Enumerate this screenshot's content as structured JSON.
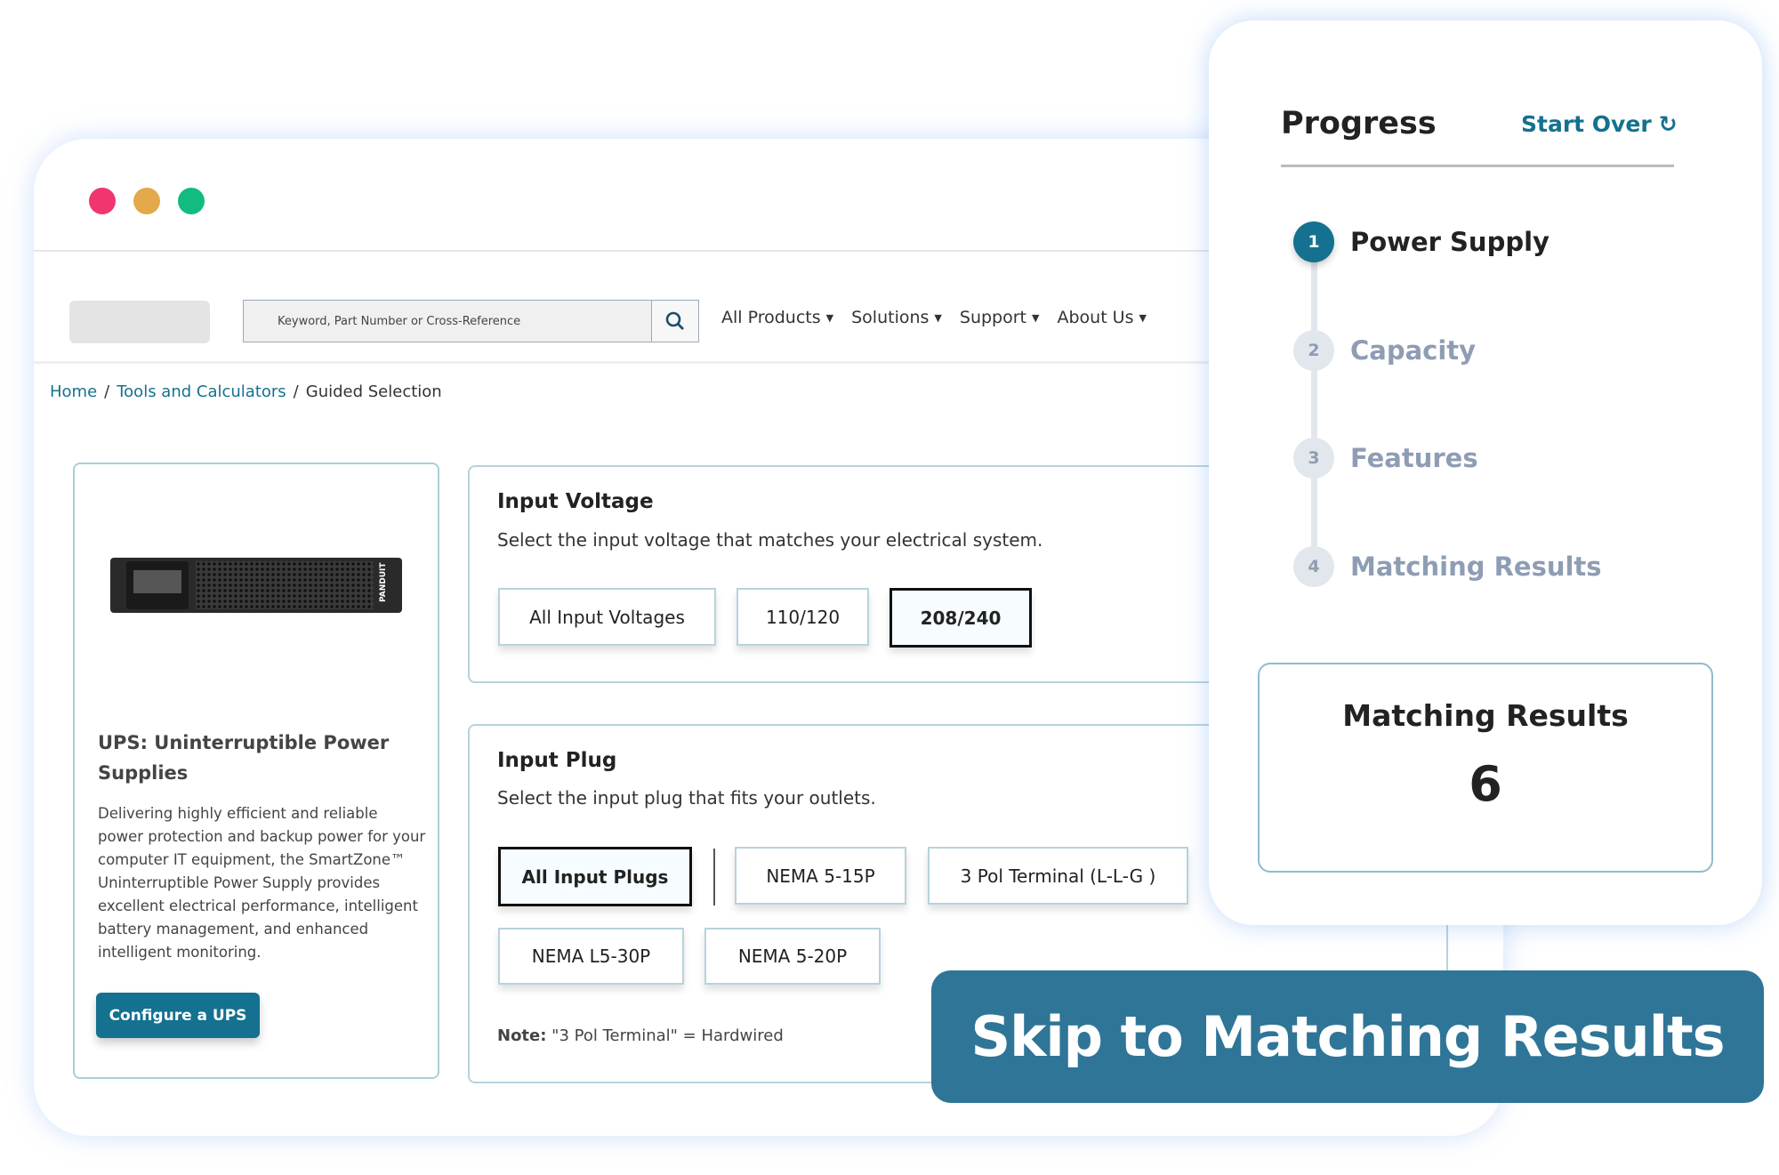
{
  "window": {
    "traffic_lights": [
      "#f0356f",
      "#e3a94a",
      "#12bc7f"
    ]
  },
  "header": {
    "search_placeholder": "Keyword, Part Number or Cross-Reference",
    "search_icon": "search-icon",
    "nav": [
      {
        "label": "All Products"
      },
      {
        "label": "Solutions"
      },
      {
        "label": "Support"
      },
      {
        "label": "About Us"
      }
    ]
  },
  "breadcrumb": {
    "items": [
      "Home",
      "Tools and Calculators",
      "Guided Selection"
    ],
    "separator": "/"
  },
  "product_card": {
    "title": "UPS: Uninterruptible Power Supplies",
    "description": "Delivering highly efficient and reliable power protection and backup power for your computer IT equipment, the SmartZone™ Uninterruptible Power Supply provides excellent electrical performance, intelligent battery management, and enhanced intelligent monitoring.",
    "button": "Configure a UPS",
    "brand": "PANDUIT"
  },
  "input_voltage": {
    "title": "Input Voltage",
    "subtitle": "Select the input voltage that matches your electrical system.",
    "options": [
      {
        "label": "All Input Voltages",
        "selected": false
      },
      {
        "label": "110/120",
        "selected": false
      },
      {
        "label": "208/240",
        "selected": true
      }
    ]
  },
  "input_plug": {
    "title": "Input Plug",
    "subtitle": "Select the input plug that fits your outlets.",
    "options": [
      {
        "label": "All Input Plugs",
        "selected": true
      },
      {
        "label": "NEMA 5-15P",
        "selected": false
      },
      {
        "label": "3 Pol Terminal (L-L-G )",
        "selected": false
      },
      {
        "label": "NEMA L5-30P",
        "selected": false
      },
      {
        "label": "NEMA 5-20P",
        "selected": false
      }
    ],
    "note_label": "Note:",
    "note_text": " \"3 Pol Terminal\" = Hardwired"
  },
  "progress": {
    "title": "Progress",
    "start_over": "Start Over",
    "steps": [
      {
        "num": "1",
        "label": "Power Supply",
        "active": true
      },
      {
        "num": "2",
        "label": "Capacity",
        "active": false
      },
      {
        "num": "3",
        "label": "Features",
        "active": false
      },
      {
        "num": "4",
        "label": "Matching Results",
        "active": false
      }
    ],
    "results_title": "Matching Results",
    "results_count": "6"
  },
  "skip_button": "Skip to Matching Results",
  "colors": {
    "accent": "#14718f",
    "skip": "#2f7597",
    "inactive": "#8e9db3"
  }
}
